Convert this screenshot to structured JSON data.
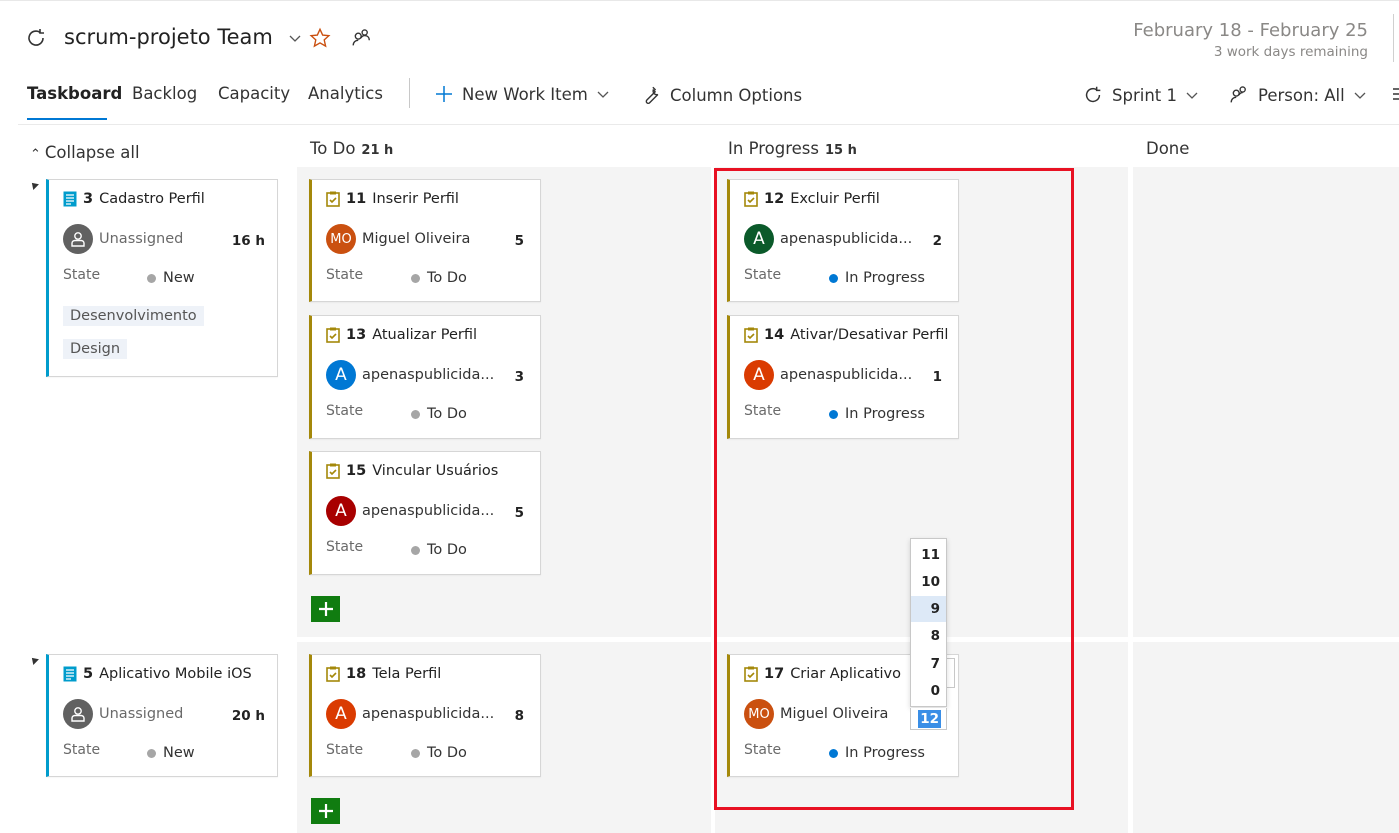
{
  "header": {
    "team_name": "scrum-projeto Team",
    "date_range": "February 18 - February 25",
    "days_remaining": "3 work days remaining"
  },
  "tabs": [
    {
      "label": "Taskboard",
      "active": true
    },
    {
      "label": "Backlog",
      "active": false
    },
    {
      "label": "Capacity",
      "active": false
    },
    {
      "label": "Analytics",
      "active": false
    }
  ],
  "toolbar": {
    "new_work_item": "New Work Item",
    "column_options": "Column Options",
    "sprint": "Sprint 1",
    "person_filter": "Person: All"
  },
  "board": {
    "collapse_all": "Collapse all",
    "columns": [
      {
        "name": "To Do",
        "hours": "21 h"
      },
      {
        "name": "In Progress",
        "hours": "15 h"
      },
      {
        "name": "Done",
        "hours": ""
      }
    ],
    "rows": [
      {
        "parent": {
          "id": "3",
          "title": "Cadastro Perfil",
          "assignee": "Unassigned",
          "hours": "16 h",
          "state_label": "State",
          "state": "New",
          "tags": [
            "Desenvolvimento",
            "Design"
          ]
        },
        "todo": [
          {
            "id": "11",
            "title": "Inserir Perfil",
            "assignee": "Miguel Oliveira",
            "initials": "MO",
            "avatar_color": "#ca5010",
            "hours": "5",
            "state_label": "State",
            "state": "To Do"
          },
          {
            "id": "13",
            "title": "Atualizar Perfil",
            "assignee": "apenaspublicida...",
            "initials": "A",
            "avatar_color": "#0078d4",
            "hours": "3",
            "state_label": "State",
            "state": "To Do"
          },
          {
            "id": "15",
            "title": "Vincular Usuários",
            "assignee": "apenaspublicida...",
            "initials": "A",
            "avatar_color": "#a80000",
            "hours": "5",
            "state_label": "State",
            "state": "To Do"
          }
        ],
        "in_progress": [
          {
            "id": "12",
            "title": "Excluir Perfil",
            "assignee": "apenaspublicida...",
            "initials": "A",
            "avatar_color": "#0b5a2a",
            "hours": "2",
            "state_label": "State",
            "state": "In Progress"
          },
          {
            "id": "14",
            "title": "Ativar/Desativar Perfil",
            "assignee": "apenaspublicida...",
            "initials": "A",
            "avatar_color": "#da3b01",
            "hours": "1",
            "state_label": "State",
            "state": "In Progress"
          }
        ]
      },
      {
        "parent": {
          "id": "5",
          "title": "Aplicativo Mobile iOS",
          "assignee": "Unassigned",
          "hours": "20 h",
          "state_label": "State",
          "state": "New"
        },
        "todo": [
          {
            "id": "18",
            "title": "Tela Perfil",
            "assignee": "apenaspublicida...",
            "initials": "A",
            "avatar_color": "#da3b01",
            "hours": "8",
            "state_label": "State",
            "state": "To Do"
          }
        ],
        "in_progress": [
          {
            "id": "17",
            "title": "Criar Aplicativo",
            "assignee": "Miguel Oliveira",
            "initials": "MO",
            "avatar_color": "#ca5010",
            "hours": "12",
            "state_label": "State",
            "state": "In Progress"
          }
        ]
      }
    ]
  },
  "hours_dropdown": {
    "options": [
      "11",
      "10",
      "9",
      "8",
      "7",
      "0"
    ],
    "hovered": "9",
    "current_value": "12"
  },
  "colors": {
    "accent": "#0078d4",
    "task_bar": "#a4880a",
    "pbi_bar": "#009ccc",
    "todo_dot": "#a6a6a6",
    "in_progress_dot": "#0078d4",
    "add_button": "#107c10",
    "highlight_box": "#e81123"
  }
}
